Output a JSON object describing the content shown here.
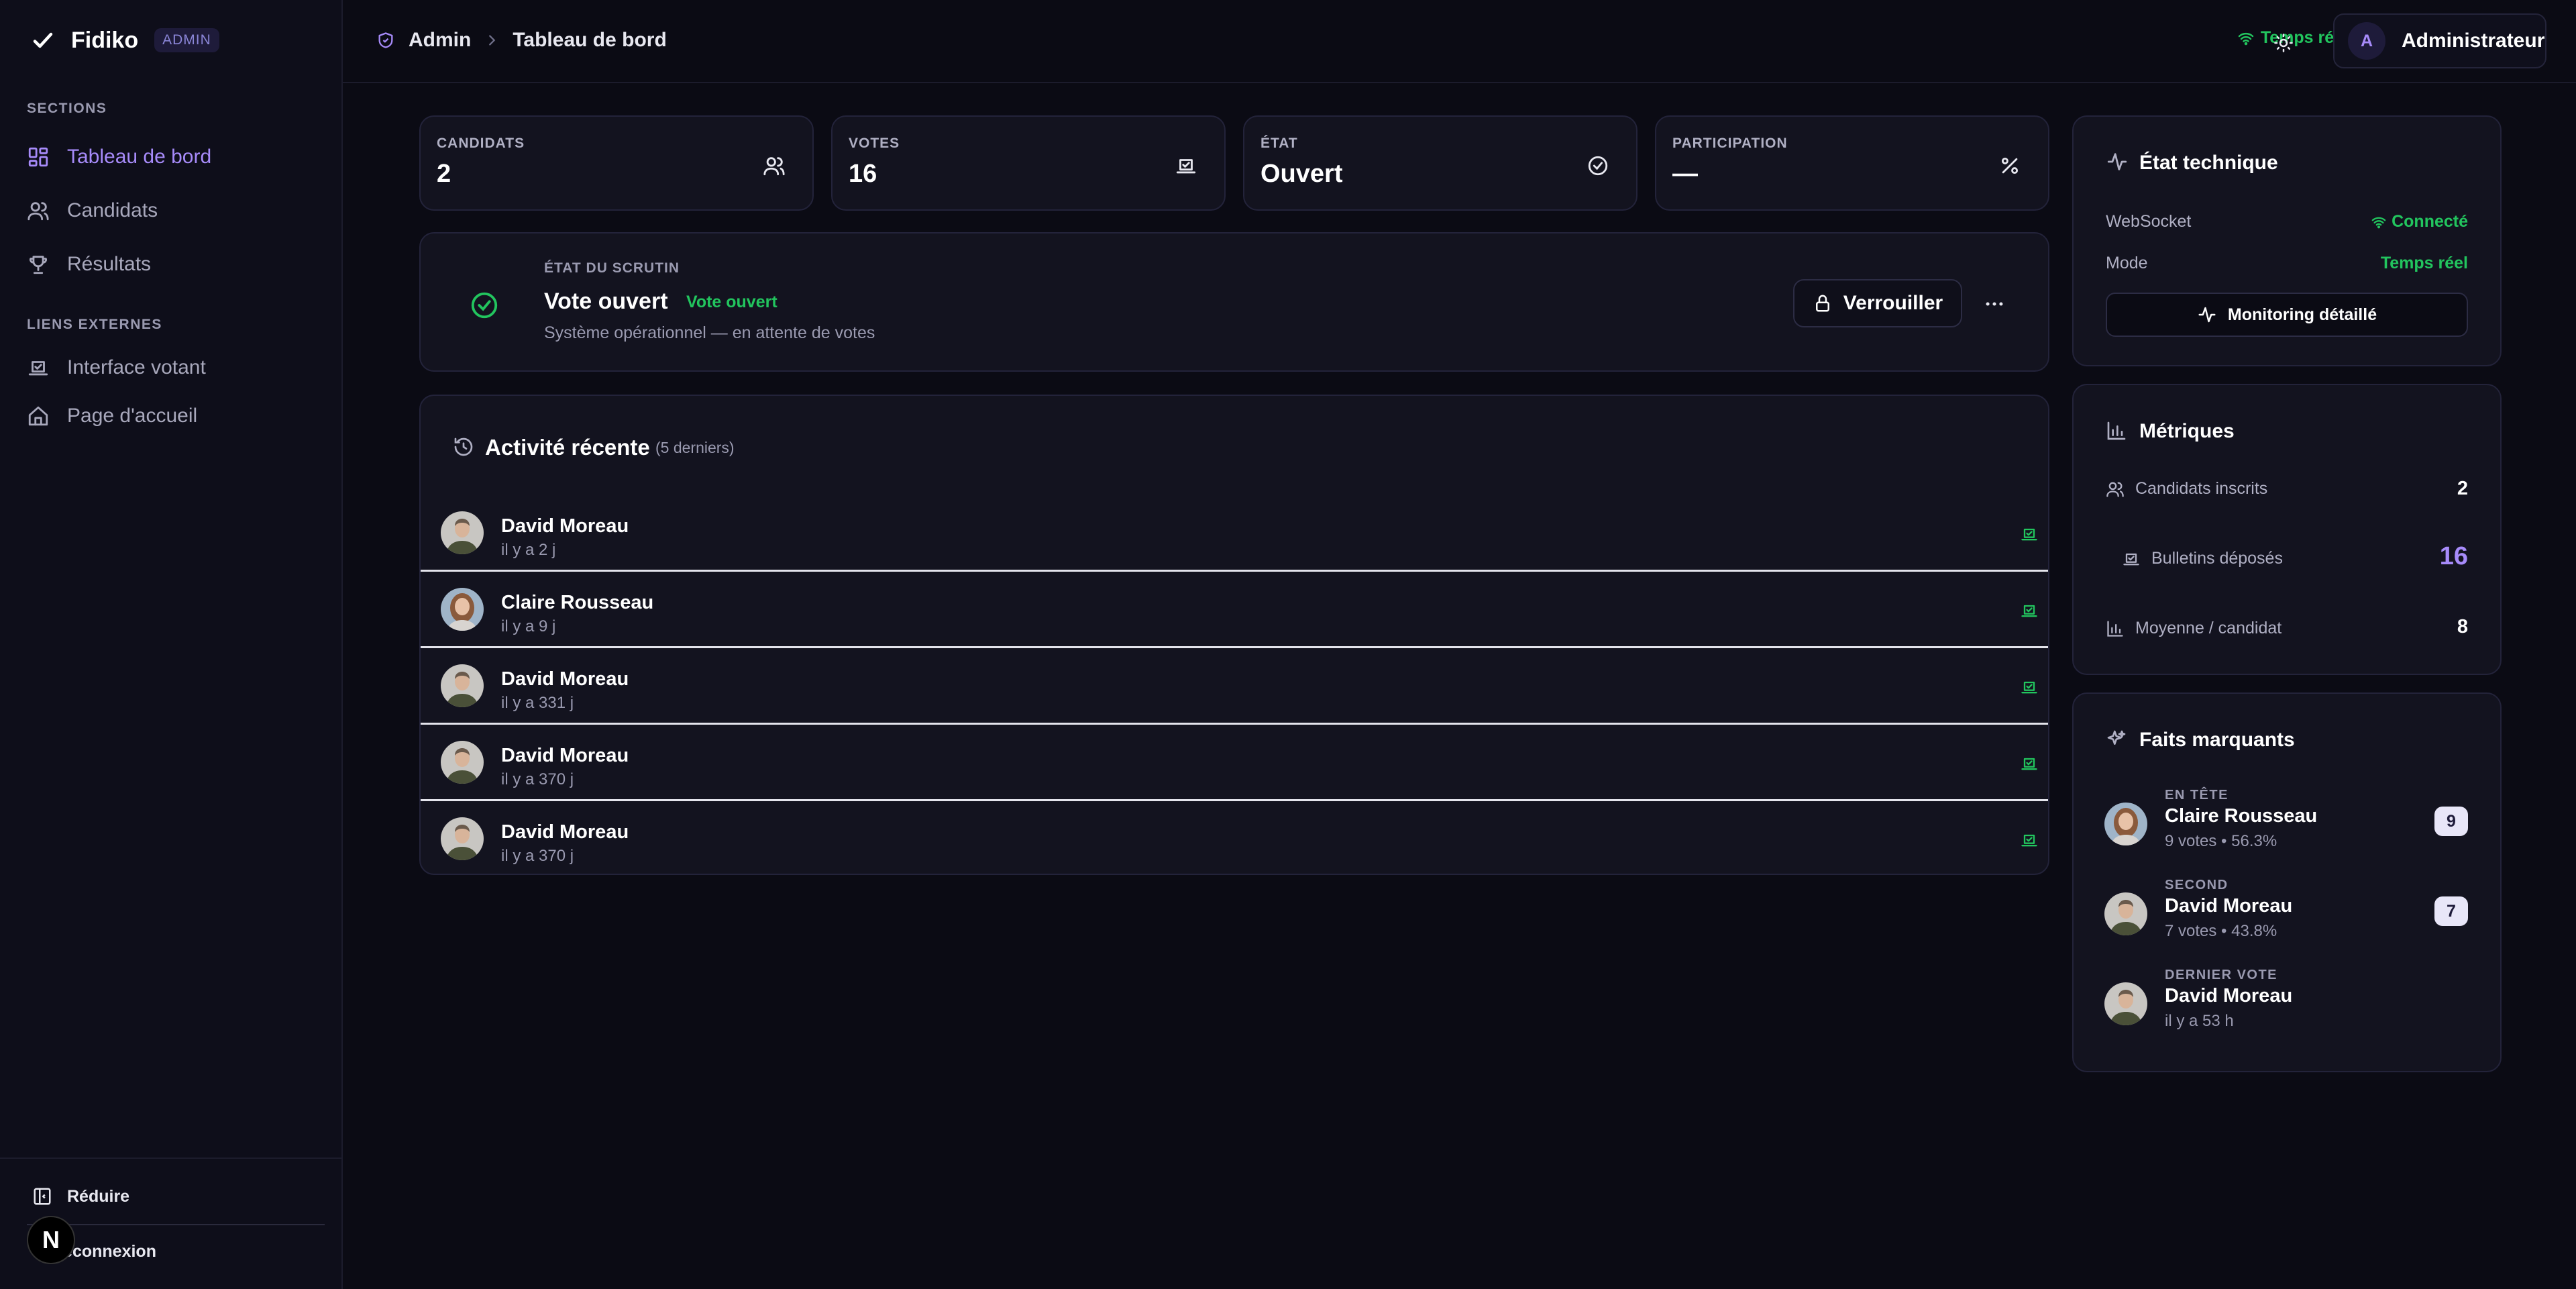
{
  "sidebar": {
    "brand": "Fidiko",
    "badge": "ADMIN",
    "sections_label": "SECTIONS",
    "items": [
      {
        "label": "Tableau de bord"
      },
      {
        "label": "Candidats"
      },
      {
        "label": "Résultats"
      }
    ],
    "external_label": "LIENS EXTERNES",
    "external_items": [
      {
        "label": "Interface votant"
      },
      {
        "label": "Page d'accueil"
      }
    ],
    "collapse_label": "Réduire",
    "logout_label": "Déconnexion",
    "n_badge": "N"
  },
  "header": {
    "breadcrumb_root": "Admin",
    "breadcrumb_current": "Tableau de bord",
    "realtime_label": "Temps réel",
    "user_initial": "A",
    "user_name": "Administrateur"
  },
  "stats": [
    {
      "label": "CANDIDATS",
      "value": "2",
      "icon": "users-icon"
    },
    {
      "label": "VOTES",
      "value": "16",
      "icon": "ballot-icon"
    },
    {
      "label": "ÉTAT",
      "value": "Ouvert",
      "icon": "check-circle-icon"
    },
    {
      "label": "PARTICIPATION",
      "value": "—",
      "icon": "percent-icon"
    }
  ],
  "scrutin": {
    "label": "ÉTAT DU SCRUTIN",
    "title": "Vote ouvert",
    "badge": "Vote ouvert",
    "subtitle": "Système opérationnel — en attente de votes",
    "lock_label": "Verrouiller"
  },
  "activity": {
    "title": "Activité récente",
    "count": "(5 derniers)",
    "rows": [
      {
        "name": "David Moreau",
        "time": "il y a 2 j",
        "face": "male"
      },
      {
        "name": "Claire Rousseau",
        "time": "il y a 9 j",
        "face": "female"
      },
      {
        "name": "David Moreau",
        "time": "il y a 331 j",
        "face": "male"
      },
      {
        "name": "David Moreau",
        "time": "il y a 370 j",
        "face": "male"
      },
      {
        "name": "David Moreau",
        "time": "il y a 370 j",
        "face": "male"
      }
    ]
  },
  "tech": {
    "title": "État technique",
    "websocket_label": "WebSocket",
    "websocket_value": "Connecté",
    "mode_label": "Mode",
    "mode_value": "Temps réel",
    "monitor_label": "Monitoring détaillé"
  },
  "metrics": {
    "title": "Métriques",
    "rows": [
      {
        "label": "Candidats inscrits",
        "value": "2"
      },
      {
        "label": "Bulletins déposés",
        "value": "16"
      },
      {
        "label": "Moyenne / candidat",
        "value": "8"
      }
    ]
  },
  "highlights": {
    "title": "Faits marquants",
    "items": [
      {
        "label": "EN TÊTE",
        "name": "Claire Rousseau",
        "sub": "9 votes • 56.3%",
        "badge": "9",
        "face": "female"
      },
      {
        "label": "SECOND",
        "name": "David Moreau",
        "sub": "7 votes • 43.8%",
        "badge": "7",
        "face": "male"
      },
      {
        "label": "DERNIER VOTE",
        "name": "David Moreau",
        "sub": "il y a 53 h",
        "face": "male"
      }
    ]
  },
  "colors": {
    "accent": "#a78bfa",
    "success": "#22c55e",
    "metric_highlight": "#a78bfa"
  }
}
